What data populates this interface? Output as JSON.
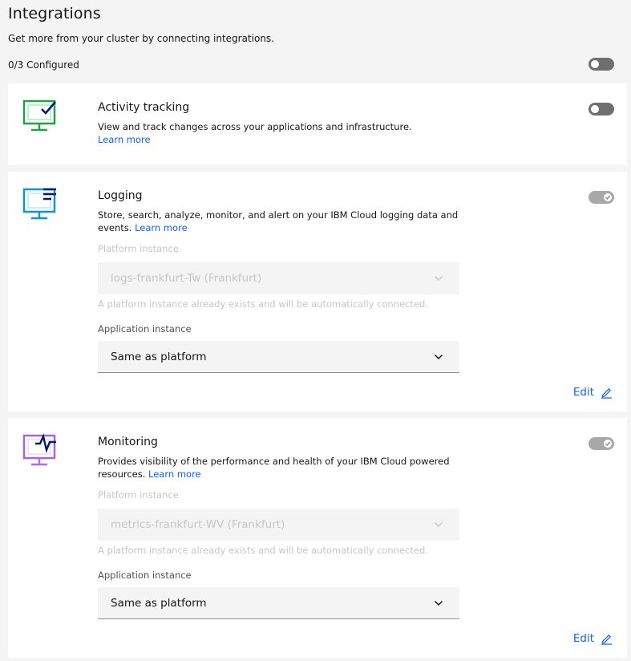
{
  "header": {
    "title": "Integrations",
    "subtitle": "Get more from your cluster by connecting integrations.",
    "configured": "0/3 Configured",
    "master_toggle": "off"
  },
  "cards": [
    {
      "title": "Activity tracking",
      "description": "View and track changes across your applications and infrastructure.",
      "learn_more": "Learn more",
      "toggle": "off",
      "icon": "monitor-check-icon",
      "icon_color": "#24a148"
    },
    {
      "title": "Logging",
      "description": "Store, search, analyze, monitor, and alert on your IBM Cloud logging data and events.",
      "learn_more": "Learn more",
      "toggle": "on-disabled",
      "icon": "monitor-logs-icon",
      "icon_color": "#1192e8",
      "platform_label": "Platform instance",
      "platform_value": "logs-frankfurt-Tw (Frankfurt)",
      "helper": "A platform instance already exists and will be automatically connected.",
      "application_label": "Application instance",
      "application_value": "Same as platform",
      "edit": "Edit"
    },
    {
      "title": "Monitoring",
      "description": "Provides visibility of the performance and health of your IBM Cloud powered resources.",
      "learn_more": "Learn more",
      "toggle": "on-disabled",
      "icon": "monitor-pulse-icon",
      "icon_color": "#a56eff",
      "platform_label": "Platform instance",
      "platform_value": "metrics-frankfurt-WV (Frankfurt)",
      "helper": "A platform instance already exists and will be automatically connected.",
      "application_label": "Application instance",
      "application_value": "Same as platform",
      "edit": "Edit"
    }
  ]
}
